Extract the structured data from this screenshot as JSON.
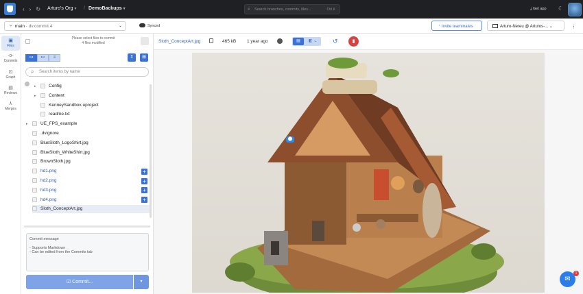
{
  "titlebar": {
    "org": "Arturo's Org",
    "repo": "DemoBackups",
    "search_placeholder": "Search branches, commits, files...",
    "search_shortcut": "Ctrl K",
    "get_app": "Get app"
  },
  "toolbar": {
    "branch": "main",
    "branch_sub": "dv.commit.4",
    "sync_status": "Synced",
    "invite": "Invite teammates",
    "workspace": "Arturo-Nereu @ Arturos-..."
  },
  "rail": {
    "items": [
      {
        "label": "Files",
        "icon": "files-icon"
      },
      {
        "label": "Commits",
        "icon": "commits-icon"
      },
      {
        "label": "Graph",
        "icon": "graph-icon"
      },
      {
        "label": "Reviews",
        "icon": "reviews-icon"
      },
      {
        "label": "Merges",
        "icon": "merges-icon"
      }
    ]
  },
  "panel": {
    "note_line1": "Please select files to commit",
    "note_line2": "4 files modified",
    "filter_placeholder": "Search items by name",
    "tree": [
      {
        "name": "Config",
        "indent": 2,
        "caret": true,
        "new": false
      },
      {
        "name": "Content",
        "indent": 2,
        "caret": true,
        "new": false
      },
      {
        "name": "KenneySandbox.uproject",
        "indent": 2,
        "caret": false,
        "new": false
      },
      {
        "name": "readme.txt",
        "indent": 2,
        "caret": false,
        "new": false
      },
      {
        "name": "UE_FPS_example",
        "indent": 1,
        "caret": true,
        "new": false
      },
      {
        "name": ".dvignore",
        "indent": 1,
        "caret": false,
        "new": false
      },
      {
        "name": "BlueSloth_LogoShirt.jpg",
        "indent": 1,
        "caret": false,
        "new": false
      },
      {
        "name": "BlueSloth_WhiteShirt.jpg",
        "indent": 1,
        "caret": false,
        "new": false
      },
      {
        "name": "BrownSloth.jpg",
        "indent": 1,
        "caret": false,
        "new": false
      },
      {
        "name": "hd1.png",
        "indent": 1,
        "caret": false,
        "new": true
      },
      {
        "name": "hd2.png",
        "indent": 1,
        "caret": false,
        "new": true
      },
      {
        "name": "hd3.png",
        "indent": 1,
        "caret": false,
        "new": true
      },
      {
        "name": "hd4.png",
        "indent": 1,
        "caret": false,
        "new": true
      },
      {
        "name": "Sloth_ConceptArt.jpg",
        "indent": 1,
        "caret": false,
        "new": false,
        "selected": true
      }
    ],
    "commit_placeholder_title": "Commit message",
    "commit_placeholder_l1": "- Supports Markdown",
    "commit_placeholder_l2": "- Can be edited from the Commits tab",
    "commit_button": "Commit..."
  },
  "file": {
    "name": "Sloth_ConceptArt.jpg",
    "size": "465 kB",
    "age": "1 year ago"
  },
  "chat_badge": "1",
  "colors": {
    "accent": "#3a72d8",
    "titlebar": "#1f2023",
    "danger": "#d94040"
  }
}
